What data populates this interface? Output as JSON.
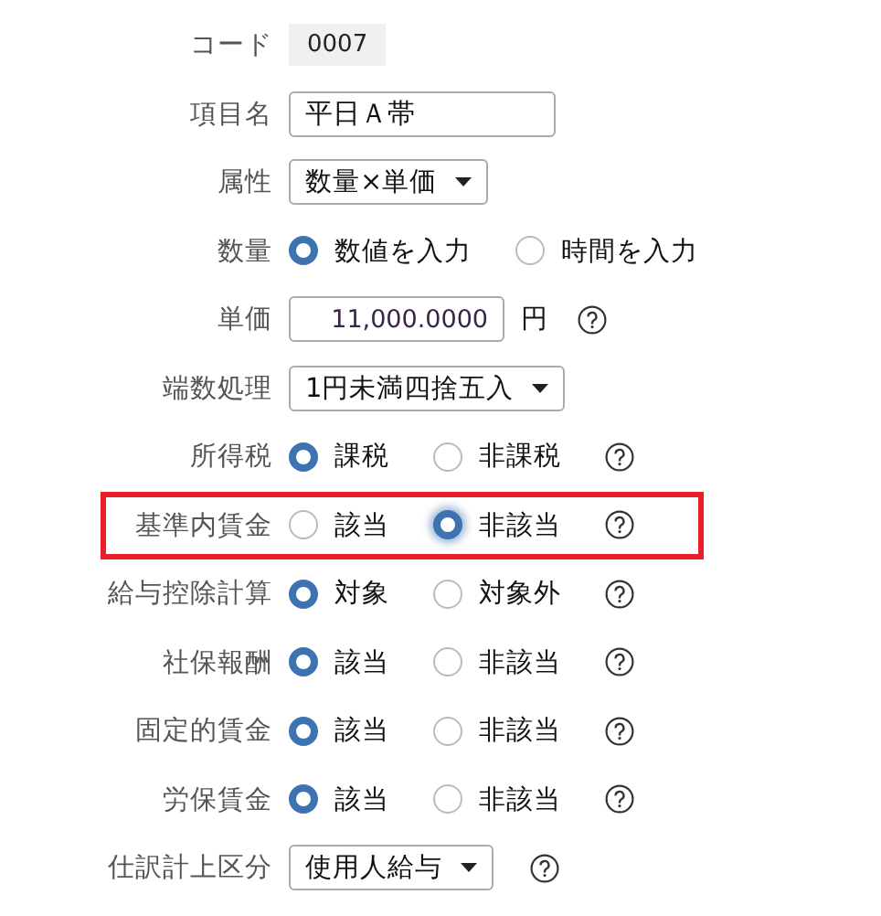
{
  "form": {
    "rows": [
      {
        "label": "コード",
        "kind": "readonly",
        "value": "0007",
        "highlighted": false,
        "help": false
      },
      {
        "label": "項目名",
        "kind": "text",
        "value": "平日Ａ帯",
        "highlighted": false,
        "help": false
      },
      {
        "label": "属性",
        "kind": "select",
        "value": "数量×単価",
        "highlighted": false,
        "help": false
      },
      {
        "label": "数量",
        "kind": "radio",
        "options": [
          {
            "label": "数値を入力",
            "selected": true
          },
          {
            "label": "時間を入力",
            "selected": false
          }
        ],
        "highlighted": false,
        "help": false
      },
      {
        "label": "単価",
        "kind": "number",
        "value": "11,000.0000",
        "unit": "円",
        "highlighted": false,
        "help": true
      },
      {
        "label": "端数処理",
        "kind": "select",
        "value": "1円未満四捨五入",
        "highlighted": false,
        "help": false
      },
      {
        "label": "所得税",
        "kind": "radio",
        "options": [
          {
            "label": "課税",
            "selected": true
          },
          {
            "label": "非課税",
            "selected": false
          }
        ],
        "highlighted": false,
        "help": true
      },
      {
        "label": "基準内賃金",
        "kind": "radio",
        "options": [
          {
            "label": "該当",
            "selected": false
          },
          {
            "label": "非該当",
            "selected": true
          }
        ],
        "highlighted": true,
        "help": true
      },
      {
        "label": "給与控除計算",
        "kind": "radio",
        "options": [
          {
            "label": "対象",
            "selected": true
          },
          {
            "label": "対象外",
            "selected": false
          }
        ],
        "highlighted": false,
        "help": true
      },
      {
        "label": "社保報酬",
        "kind": "radio",
        "options": [
          {
            "label": "該当",
            "selected": true
          },
          {
            "label": "非該当",
            "selected": false
          }
        ],
        "highlighted": false,
        "help": true
      },
      {
        "label": "固定的賃金",
        "kind": "radio",
        "options": [
          {
            "label": "該当",
            "selected": true
          },
          {
            "label": "非該当",
            "selected": false
          }
        ],
        "highlighted": false,
        "help": true
      },
      {
        "label": "労保賃金",
        "kind": "radio",
        "options": [
          {
            "label": "該当",
            "selected": true
          },
          {
            "label": "非該当",
            "selected": false
          }
        ],
        "highlighted": false,
        "help": true
      },
      {
        "label": "仕訳計上区分",
        "kind": "select",
        "value": "使用人給与",
        "highlighted": false,
        "help": true
      }
    ]
  }
}
